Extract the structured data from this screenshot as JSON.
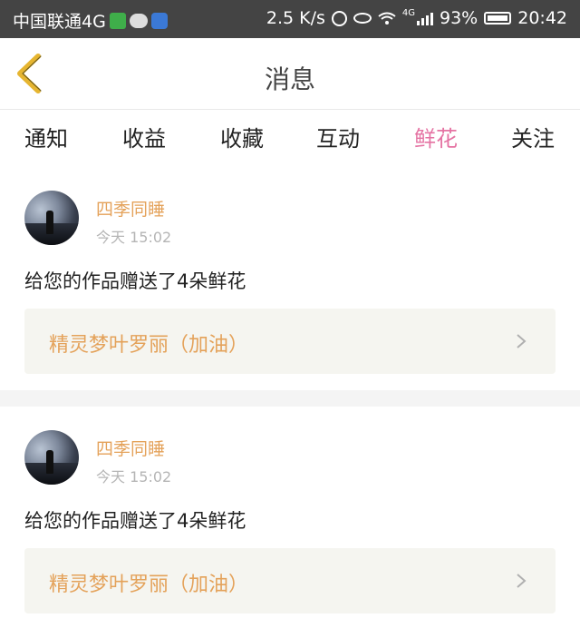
{
  "status_bar": {
    "carrier": "中国联通4G",
    "net_speed": "2.5 K/s",
    "battery": "93%",
    "time": "20:42",
    "network_badge": "4G"
  },
  "nav": {
    "title": "消息"
  },
  "tabs": [
    {
      "label": "通知",
      "active": false
    },
    {
      "label": "收益",
      "active": false
    },
    {
      "label": "收藏",
      "active": false
    },
    {
      "label": "互动",
      "active": false
    },
    {
      "label": "鲜花",
      "active": true
    },
    {
      "label": "关注",
      "active": false
    }
  ],
  "notifications": [
    {
      "username": "四季同睡",
      "time": "今天 15:02",
      "message": "给您的作品赠送了4朵鲜花",
      "work_title": "精灵梦叶罗丽（加油）"
    },
    {
      "username": "四季同睡",
      "time": "今天 15:02",
      "message": "给您的作品赠送了4朵鲜花",
      "work_title": "精灵梦叶罗丽（加油）"
    }
  ],
  "colors": {
    "accent_pink": "#e573a3",
    "username_orange": "#e4a25a",
    "back_arrow": "#e6b530",
    "status_bar_bg": "#444444"
  }
}
